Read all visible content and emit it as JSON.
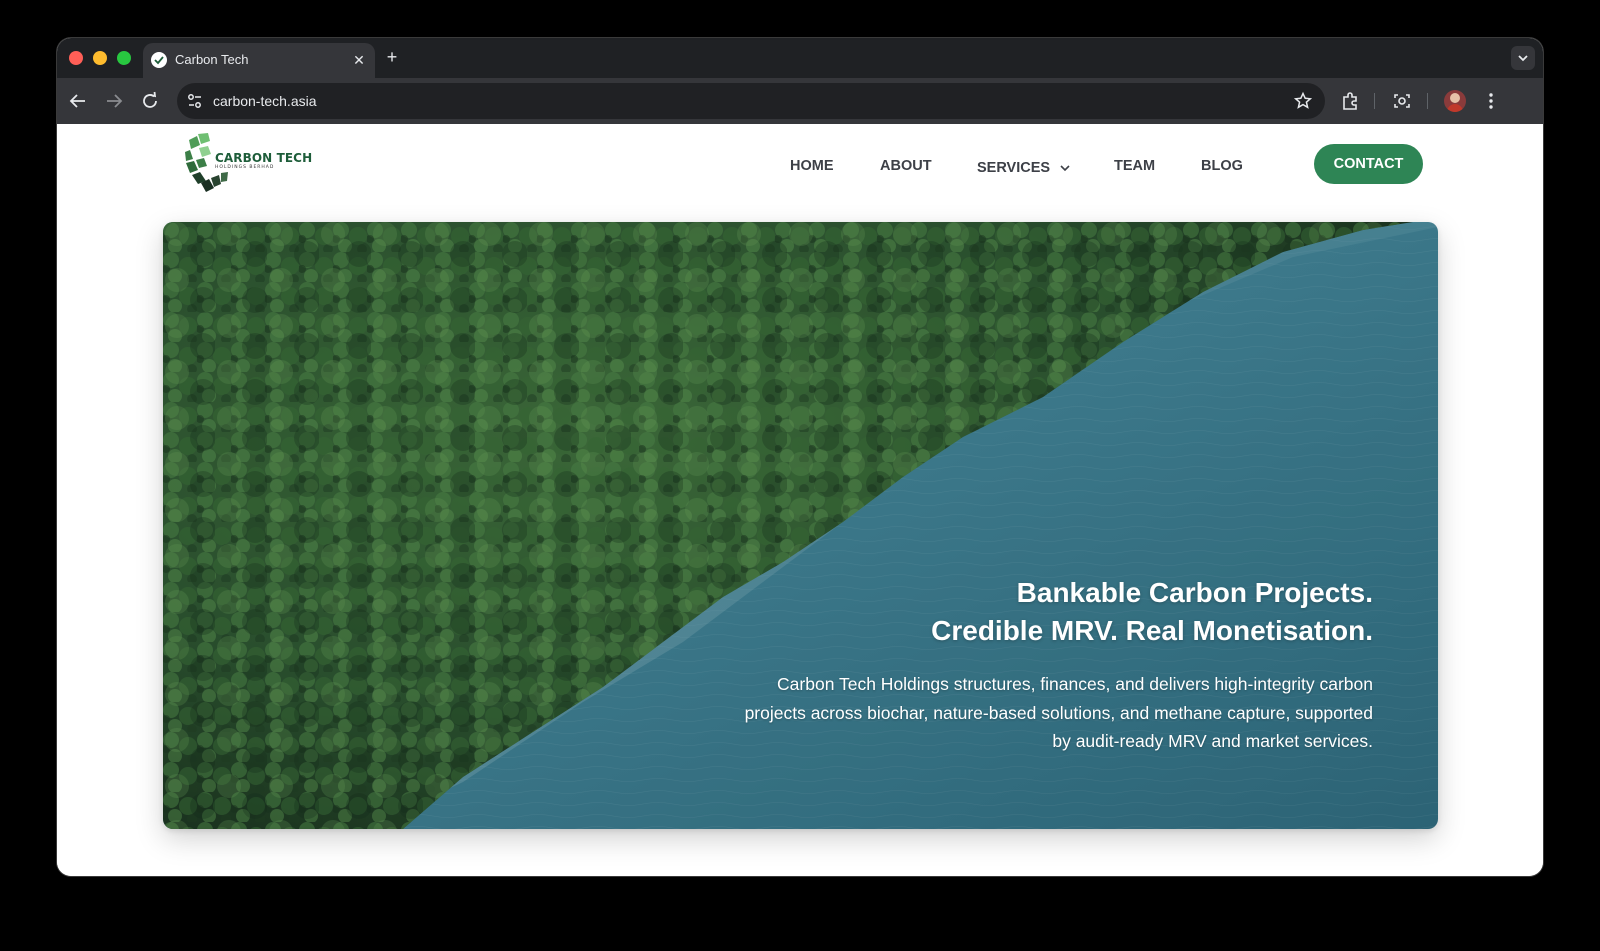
{
  "browser": {
    "tab": {
      "title": "Carbon Tech",
      "close_glyph": "✕",
      "favicon": "carbon-tech-favicon"
    },
    "new_tab_glyph": "+",
    "address": "carbon-tech.asia",
    "icons": [
      "back-icon",
      "forward-icon",
      "reload-icon",
      "site-settings-icon",
      "bookmark-star-icon",
      "extensions-icon",
      "screenshot-icon",
      "profile-avatar",
      "menu-dots-icon",
      "tab-search-icon"
    ]
  },
  "site": {
    "logo": {
      "title": "CARBON TECH",
      "subtitle": "HOLDINGS BERHAD"
    },
    "nav": [
      {
        "label": "HOME"
      },
      {
        "label": "ABOUT"
      },
      {
        "label": "SERVICES"
      },
      {
        "label": "TEAM"
      },
      {
        "label": "BLOG"
      }
    ],
    "contact_label": "CONTACT",
    "hero": {
      "title_line1": "Bankable Carbon Projects.",
      "title_line2": "Credible MRV. Real Monetisation.",
      "body_line1": "Carbon Tech Holdings structures, finances, and delivers high-integrity carbon",
      "body_line2": "projects across biochar, nature-based solutions, and methane capture, supported",
      "body_line3": "by audit-ready MRV and market services."
    }
  },
  "colors": {
    "brand_green": "#2e8555",
    "logo_green": "#1e5d3a",
    "nav_text": "#3d4047",
    "water": "#3f7f92",
    "forest": "#24482a"
  }
}
